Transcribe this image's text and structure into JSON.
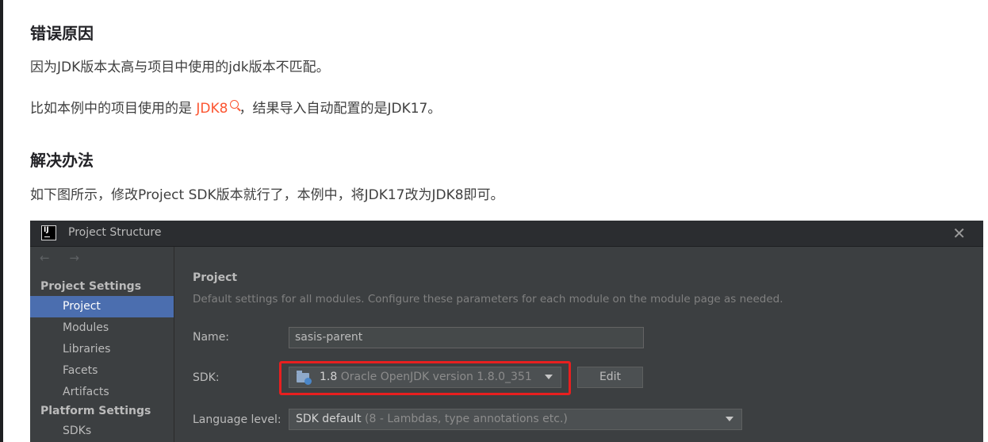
{
  "article": {
    "heading1": "错误原因",
    "para1": "因为JDK版本太高与项目中使用的jdk版本不匹配。",
    "para2_before": "比如本例中的项目使用的是 ",
    "para2_link": "JDK8",
    "para2_after": "，结果导入自动配置的是JDK17。",
    "heading2": "解决办法",
    "para3": "如下图所示，修改Project SDK版本就行了，本例中，将JDK17改为JDK8即可。",
    "link_color": "#fc5531",
    "link_icon": "search-icon"
  },
  "dialog": {
    "title": "Project Structure",
    "app_icon_text": "IJ",
    "nav_arrows": "← →",
    "sidebar": {
      "group1": "Project Settings",
      "items1": [
        "Project",
        "Modules",
        "Libraries",
        "Facets",
        "Artifacts"
      ],
      "group2": "Platform Settings",
      "items2": [
        "SDKs"
      ],
      "selected": "Project",
      "selected_color": "#4b6eaf"
    },
    "main": {
      "title": "Project",
      "description": "Default settings for all modules. Configure these parameters for each module on the module page as needed.",
      "name_label": "Name:",
      "name_value": "sasis-parent",
      "sdk_label": "SDK:",
      "sdk_version": "1.8",
      "sdk_description": "Oracle OpenJDK version 1.8.0_351",
      "edit_label": "Edit",
      "language_label": "Language level:",
      "language_value": "SDK default",
      "language_desc": "(8 - Lambdas, type annotations etc.)",
      "highlight_color": "#e81f1f"
    }
  }
}
